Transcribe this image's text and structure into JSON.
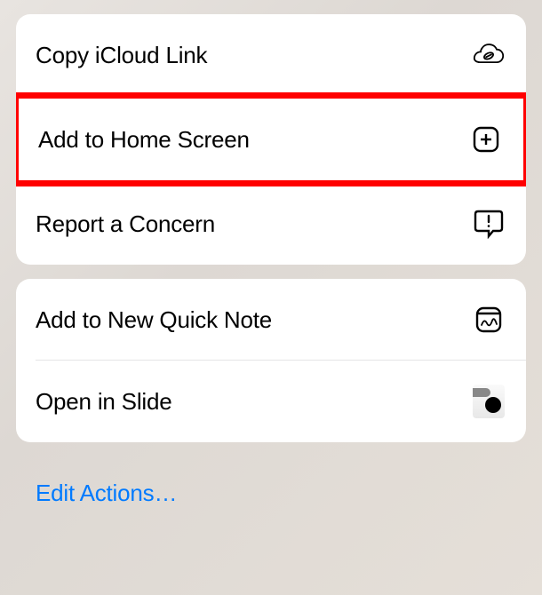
{
  "group1": {
    "items": [
      {
        "label": "Copy iCloud Link",
        "icon": "cloud-link-icon"
      },
      {
        "label": "Add to Home Screen",
        "icon": "add-square-icon",
        "highlighted": true
      },
      {
        "label": "Report a Concern",
        "icon": "report-speech-icon"
      }
    ]
  },
  "group2": {
    "items": [
      {
        "label": "Add to New Quick Note",
        "icon": "quick-note-icon"
      },
      {
        "label": "Open in Slide",
        "icon": "slide-app-icon"
      }
    ]
  },
  "footer": {
    "edit_actions_label": "Edit Actions…"
  }
}
